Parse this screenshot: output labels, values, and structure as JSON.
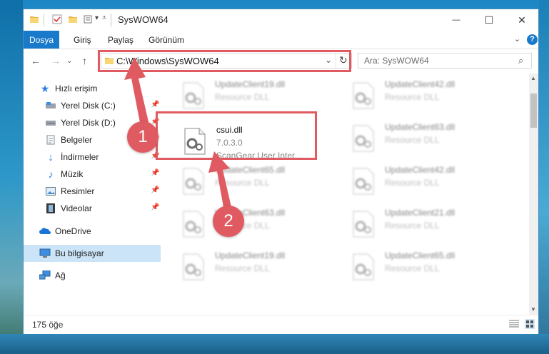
{
  "window": {
    "title": "SysWOW64",
    "controls": {
      "minimize": "—",
      "maximize": "☐",
      "close": "✕"
    }
  },
  "ribbon": {
    "tabs": [
      "Dosya",
      "Giriş",
      "Paylaş",
      "Görünüm"
    ],
    "help": "?"
  },
  "address": {
    "path": "C:\\Windows\\SysWOW64",
    "search_placeholder": "Ara: SysWOW64"
  },
  "sidebar": {
    "items": [
      {
        "label": "Hızlı erişim",
        "icon": "star-icon",
        "pinned": false
      },
      {
        "label": "Yerel Disk (C:)",
        "icon": "drive-icon",
        "pinned": true
      },
      {
        "label": "Yerel Disk (D:)",
        "icon": "drive-icon",
        "pinned": true
      },
      {
        "label": "Belgeler",
        "icon": "documents-icon",
        "pinned": true
      },
      {
        "label": "İndirmeler",
        "icon": "download-icon",
        "pinned": true
      },
      {
        "label": "Müzik",
        "icon": "music-icon",
        "pinned": true
      },
      {
        "label": "Resimler",
        "icon": "pictures-icon",
        "pinned": true
      },
      {
        "label": "Videolar",
        "icon": "videos-icon",
        "pinned": true
      },
      {
        "label": "OneDrive",
        "icon": "cloud-icon",
        "pinned": false
      },
      {
        "label": "Bu bilgisayar",
        "icon": "computer-icon",
        "pinned": false,
        "selected": true
      },
      {
        "label": "Ağ",
        "icon": "network-icon",
        "pinned": false
      }
    ]
  },
  "files": {
    "highlighted": {
      "name": "csui.dll",
      "version": "7.0.3.0",
      "description": "ScanGear User Inter..."
    },
    "background": [
      {
        "name": "UpdateClient19.dll",
        "type": "Resource DLL"
      },
      {
        "name": "UpdateClient42.dll",
        "type": "Resource DLL"
      },
      {
        "name": "UpdateClient63.dll",
        "type": "Resource DLL"
      },
      {
        "name": "UpdateClient65.dll",
        "type": "Resource DLL"
      },
      {
        "name": "UpdateClient42.dll",
        "type": "Resource DLL"
      },
      {
        "name": "UpdateClient63.dll",
        "type": "Resource DLL"
      },
      {
        "name": "UpdateClient21.dll",
        "type": "Resource DLL"
      },
      {
        "name": "UpdateClient19.dll",
        "type": "Resource DLL"
      },
      {
        "name": "UpdateClient65.dll",
        "type": "Resource DLL"
      }
    ]
  },
  "status": {
    "count": "175 öğe"
  },
  "markers": [
    "1",
    "2"
  ],
  "colors": {
    "accent": "#1979ca",
    "highlight": "#e05a61",
    "selection": "#cce4f7"
  }
}
